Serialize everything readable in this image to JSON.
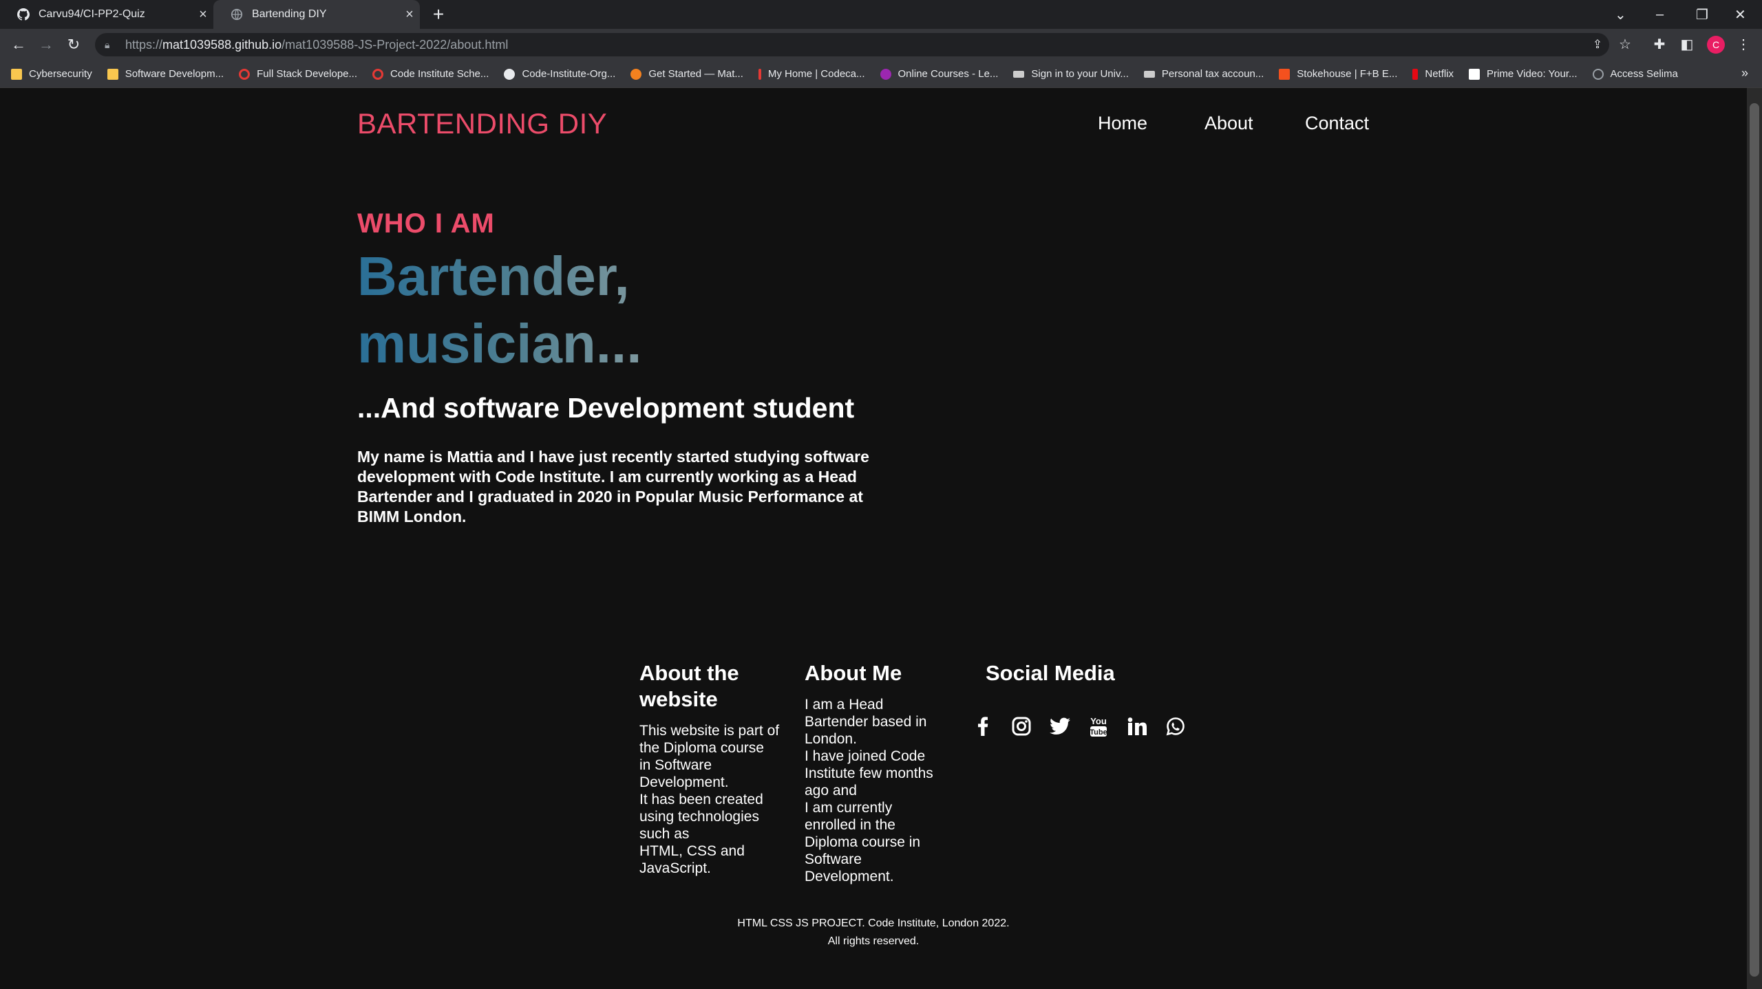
{
  "browser": {
    "tabs": [
      {
        "label": "Carvu94/CI-PP2-Quiz",
        "icon": "github-icon"
      },
      {
        "label": "Bartending DIY",
        "icon": "globe-icon"
      }
    ],
    "url": {
      "protocol": "https://",
      "host": "mat1039588.github.io",
      "path": "/mat1039588-JS-Project-2022/about.html"
    },
    "profile_initial": "C",
    "bookmarks": [
      {
        "label": "Cybersecurity",
        "color": "#f9c74f"
      },
      {
        "label": "Software Developm...",
        "color": "#f9c74f"
      },
      {
        "label": "Full Stack Develope...",
        "color": "#e53935"
      },
      {
        "label": "Code Institute Sche...",
        "color": "#e53935"
      },
      {
        "label": "Code-Institute-Org...",
        "color": "#ffffff"
      },
      {
        "label": "Get Started — Mat...",
        "color": "#f4811f"
      },
      {
        "label": "My Home | Codeca...",
        "color": "#e53935"
      },
      {
        "label": "Online Courses - Le...",
        "color": "#9c27b0"
      },
      {
        "label": "Sign in to your Univ...",
        "color": "#cccccc"
      },
      {
        "label": "Personal tax accoun...",
        "color": "#cccccc"
      },
      {
        "label": "Stokehouse | F+B E...",
        "color": "#f4511e"
      },
      {
        "label": "Netflix",
        "color": "#e50914"
      },
      {
        "label": "Prime Video: Your...",
        "color": "#ffffff"
      },
      {
        "label": "Access Selima",
        "color": "#9aa0a6"
      }
    ]
  },
  "site": {
    "brand": "BARTENDING DIY",
    "nav": [
      "Home",
      "About",
      "Contact"
    ],
    "who": "WHO I AM",
    "headline_line1": "Bartender,",
    "headline_line2": "musician...",
    "subhead": "...And software Development student",
    "intro": "My name is Mattia and I have just recently started studying software development with Code Institute. I am currently working as a Head Bartender and I graduated in 2020 in Popular Music Performance at BIMM London.",
    "footer": {
      "about_website_title": "About the website",
      "about_website_lines": [
        "This website is part of",
        "the Diploma course",
        "in Software",
        "Development.",
        "It has been created",
        "using technologies",
        "such as",
        "HTML, CSS and",
        "JavaScript."
      ],
      "about_me_title": "About Me",
      "about_me_lines": [
        "I am a Head",
        "Bartender based in",
        "London.",
        "I have joined Code",
        "Institute few months",
        "ago and",
        "I am currently",
        "enrolled in the",
        "Diploma course in",
        "Software",
        "Development."
      ],
      "social_title": "Social Media",
      "social_icons": [
        "facebook-icon",
        "instagram-icon",
        "twitter-icon",
        "youtube-icon",
        "linkedin-icon",
        "whatsapp-icon"
      ],
      "copyright_line1": "HTML CSS JS PROJECT. Code Institute, London 2022.",
      "copyright_line2": "All rights reserved."
    },
    "colors": {
      "accent": "#ec4c6a",
      "background": "#111111"
    }
  }
}
